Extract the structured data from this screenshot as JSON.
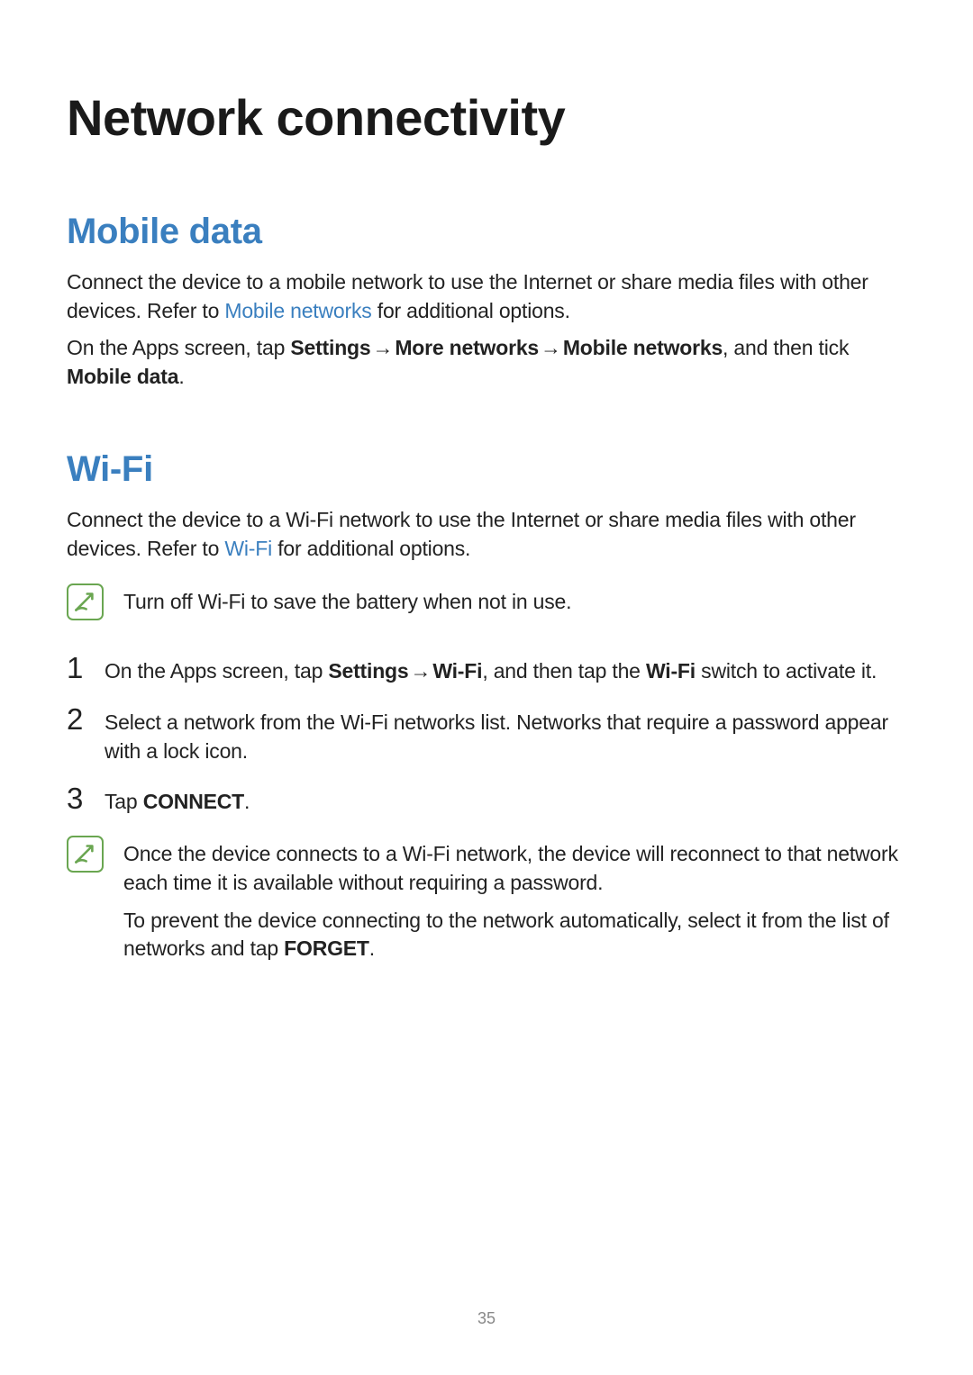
{
  "pageTitle": "Network connectivity",
  "pageNumber": "35",
  "mobile": {
    "heading": "Mobile data",
    "p1_a": "Connect the device to a mobile network to use the Internet or share media files with other devices. Refer to ",
    "p1_link": "Mobile networks",
    "p1_b": " for additional options.",
    "p2_a": "On the Apps screen, tap ",
    "p2_settings": "Settings",
    "p2_arrow1": " → ",
    "p2_more": "More networks",
    "p2_arrow2": " → ",
    "p2_mnet": "Mobile networks",
    "p2_b": ", and then tick ",
    "p2_mdata": "Mobile data",
    "p2_c": "."
  },
  "wifi": {
    "heading": "Wi-Fi",
    "p1_a": "Connect the device to a Wi-Fi network to use the Internet or share media files with other devices. Refer to ",
    "p1_link": "Wi-Fi",
    "p1_b": " for additional options.",
    "note1": "Turn off Wi-Fi to save the battery when not in use.",
    "steps": {
      "n1": "1",
      "s1_a": "On the Apps screen, tap ",
      "s1_settings": "Settings",
      "s1_arrow": " → ",
      "s1_wifi": "Wi-Fi",
      "s1_b": ", and then tap the ",
      "s1_wifi2": "Wi-Fi",
      "s1_c": " switch to activate it.",
      "n2": "2",
      "s2": "Select a network from the Wi-Fi networks list. Networks that require a password appear with a lock icon.",
      "n3": "3",
      "s3_a": "Tap ",
      "s3_connect": "CONNECT",
      "s3_b": "."
    },
    "note2_p1": "Once the device connects to a Wi-Fi network, the device will reconnect to that network each time it is available without requiring a password.",
    "note2_p2_a": "To prevent the device connecting to the network automatically, select it from the list of networks and tap ",
    "note2_p2_forget": "FORGET",
    "note2_p2_b": "."
  }
}
